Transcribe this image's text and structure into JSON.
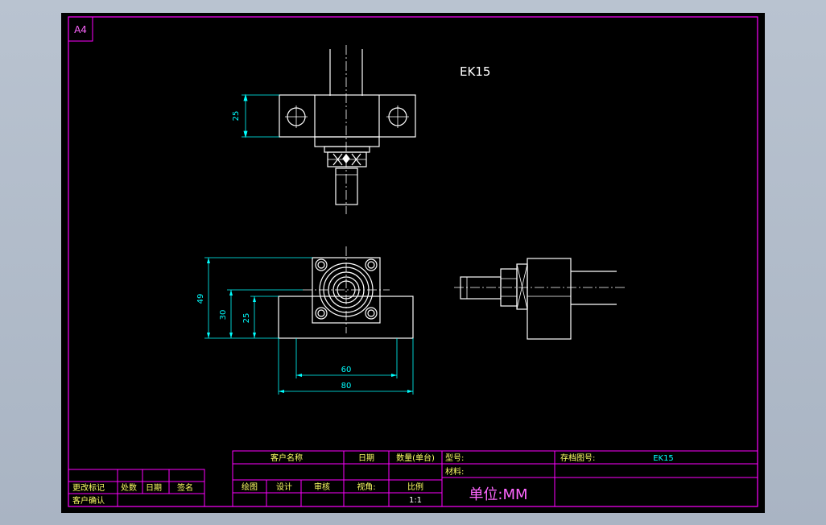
{
  "sheet": {
    "paper_size": "A4",
    "part_label": "EK15"
  },
  "dimensions": {
    "top_view_height": "25",
    "front_total_height": "49",
    "front_center_height": "30",
    "front_base_height": "25",
    "hole_spacing": "60",
    "overall_width": "80"
  },
  "title_block": {
    "customer_name": "客户名称",
    "date": "日期",
    "quantity": "数量(单台)",
    "model_no": "型号:",
    "drawing_no_label": "存档图号:",
    "drawing_no": "EK15",
    "material": "材料:",
    "drawn_by": "绘图",
    "designed_by": "设计",
    "reviewed_by": "审核",
    "projection": "视角:",
    "scale_label": "比例",
    "scale_value": "1:1",
    "unit": "单位:MM"
  },
  "revision_block": {
    "change_mark": "更改标记",
    "count": "处数",
    "date": "日期",
    "signature": "签名",
    "customer_confirm": "客户确认"
  },
  "colors": {
    "frame": "#ff00ff",
    "outline": "#ffffff",
    "dimension": "#00ffff",
    "unit_text": "#ff66ff",
    "text": "#ffff66"
  }
}
